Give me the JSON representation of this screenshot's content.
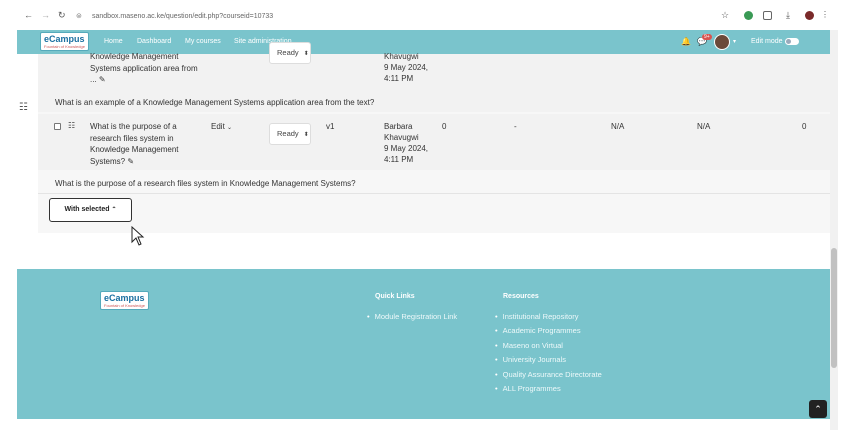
{
  "browser": {
    "url": "sandbox.maseno.ac.ke/question/edit.php?courseid=10733"
  },
  "navbar": {
    "logo_text": "eCampus",
    "logo_tagline": "Fountain of Knowledge",
    "links": [
      "Home",
      "Dashboard",
      "My courses",
      "Site administration"
    ],
    "edit_mode_label": "Edit mode",
    "notification_badge": "9+",
    "accent": "#7ac4cc"
  },
  "question_rows": [
    {
      "name": "Knowledge Management Systems application area from ...",
      "name_lines": [
        "Knowledge Management",
        "Systems application area from",
        "..."
      ],
      "status": "Ready",
      "author_lines": [
        "Khavugwi",
        "9 May 2024,",
        "4:11 PM"
      ],
      "description": "What is an example of a Knowledge Management Systems application area from the text?"
    },
    {
      "name_lines": [
        "What is the purpose of a",
        "research files system in",
        "Knowledge Management",
        "Systems?"
      ],
      "actions": "Edit",
      "status": "Ready",
      "version": "v1",
      "author_lines": [
        "Barbara",
        "Khavugwi",
        "9 May 2024,",
        "4:11 PM"
      ],
      "usage": "0",
      "last_used": "-",
      "facility": "N/A",
      "discrimination": "N/A",
      "comments": "0",
      "description": "What is the purpose of a research files system in Knowledge Management Systems?"
    }
  ],
  "bulk": {
    "with_selected_label": "With selected"
  },
  "footer": {
    "logo_text": "eCampus",
    "logo_tagline": "Fountain of Knowledge",
    "quick_links_title": "Quick Links",
    "quick_links": [
      "Module Registration Link"
    ],
    "resources_title": "Resources",
    "resources": [
      "Institutional Repository",
      "Academic Programmes",
      "Maseno on Virtual",
      "University Journals",
      "Quality Assurance Directorate",
      "ALL Programmes"
    ]
  }
}
